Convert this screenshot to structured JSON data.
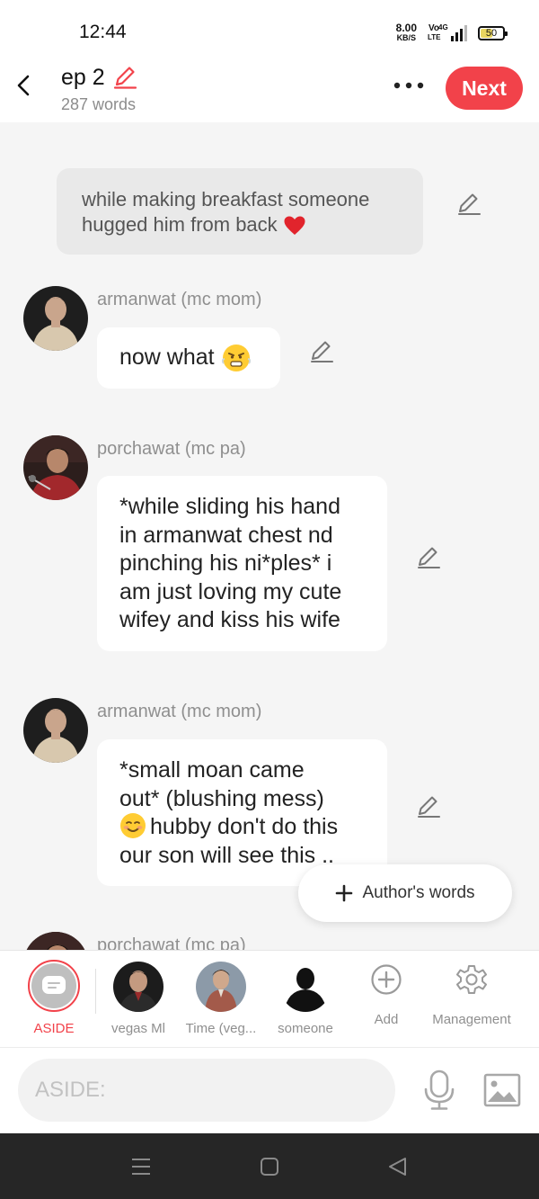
{
  "status_bar": {
    "time": "12:44",
    "net_speed_value": "8.00",
    "net_speed_unit": "KB/S",
    "volte_top": "Vo",
    "volte_bottom": "LTE",
    "network": "4G",
    "battery": "50"
  },
  "header": {
    "title": "ep 2",
    "word_count": "287 words",
    "next_label": "Next"
  },
  "chat": {
    "aside_text": "while making breakfast someone hugged him from back",
    "messages": [
      {
        "speaker": "armanwat (mc mom)",
        "lines": [
          "now what"
        ]
      },
      {
        "speaker": "porchawat (mc pa)",
        "lines": [
          "*while sliding his hand",
          "in armanwat chest nd",
          "pinching his ni*ples* i",
          "am just loving my cute",
          "wifey and kiss his wife"
        ]
      },
      {
        "speaker": "armanwat (mc mom)",
        "lines": [
          "*small moan came",
          "out* (blushing mess)",
          "hubby don't do this",
          "our son will see this .."
        ]
      },
      {
        "speaker": "porchawat (mc pa)"
      }
    ],
    "authors_words_label": "Author's words"
  },
  "characters": [
    {
      "label": "ASIDE",
      "active": true
    },
    {
      "label": "vegas Ml"
    },
    {
      "label": "Time (veg..."
    },
    {
      "label": "someone"
    },
    {
      "label": "Add"
    },
    {
      "label": "Management"
    }
  ],
  "input": {
    "placeholder": "ASIDE:"
  },
  "colors": {
    "accent": "#f2424a",
    "background": "#f5f5f5",
    "aside_bubble": "#e9e9e9"
  }
}
